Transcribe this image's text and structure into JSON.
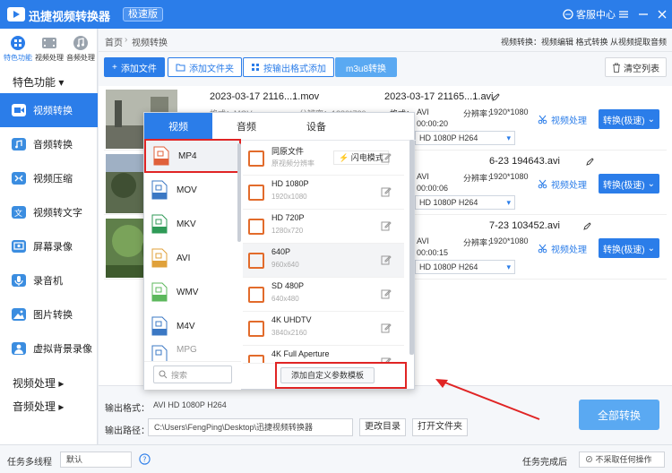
{
  "app": {
    "title": "迅捷视频转换器",
    "badge": "极速版",
    "service": "客服中心"
  },
  "sidebar": {
    "top_icons": [
      {
        "label": "特色功能",
        "icon": "grid-icon"
      },
      {
        "label": "视频处理",
        "icon": "film-icon"
      },
      {
        "label": "音频处理",
        "icon": "music-icon"
      }
    ],
    "section_featured": "特色功能",
    "items": [
      {
        "label": "视频转换",
        "icon": "video-convert-icon",
        "color": "#2b7de9"
      },
      {
        "label": "音频转换",
        "icon": "audio-convert-icon",
        "color": "#3b8de0"
      },
      {
        "label": "视频压缩",
        "icon": "compress-icon",
        "color": "#3b8de0"
      },
      {
        "label": "视频转文字",
        "icon": "video-to-text-icon",
        "color": "#3b8de0"
      },
      {
        "label": "屏幕录像",
        "icon": "screen-record-icon",
        "color": "#3b8de0"
      },
      {
        "label": "录音机",
        "icon": "recorder-icon",
        "color": "#3b8de0"
      },
      {
        "label": "图片转换",
        "icon": "image-convert-icon",
        "color": "#3b8de0"
      },
      {
        "label": "虚拟背景录像",
        "icon": "virtual-bg-icon",
        "color": "#3b8de0"
      }
    ],
    "section_video": "视频处理",
    "section_audio": "音频处理"
  },
  "breadcrumb": {
    "home": "首页",
    "current": "视频转换",
    "links": "视频转换：视频编辑 格式转换 从视频提取音频"
  },
  "toolbar": {
    "add_file": "添加文件",
    "add_folder": "添加文件夹",
    "add_by_format": "按输出格式添加",
    "m3u8": "m3u8转换",
    "clear": "清空列表"
  },
  "files": [
    {
      "src_name": "2023-03-17 2116...1.mov",
      "src_format": "格式：MOV",
      "src_res": "分辨率：1280*720",
      "out_name": "2023-03-17 21165...1.avi",
      "format_label": "格式：",
      "format": "AVI",
      "res_label": "分辨率：",
      "res": "1920*1080",
      "duration": "00:00:20",
      "preset": "HD 1080P H264",
      "process": "视频处理",
      "convert": "转换(极速)"
    },
    {
      "out_name": "6-23 194643.avi",
      "format": "AVI",
      "res_label": "分辨率：",
      "res": "1920*1080",
      "duration": "00:00:06",
      "preset": "HD 1080P H264",
      "process": "视频处理",
      "convert": "转换(极速)"
    },
    {
      "out_name": "7-23 103452.avi",
      "format": "AVI",
      "res_label": "分辨率：",
      "res": "1920*1080",
      "duration": "00:00:15",
      "preset": "HD 1080P H264",
      "process": "视频处理",
      "convert": "转换(极速)"
    }
  ],
  "popup": {
    "tabs": [
      "视频",
      "音频",
      "设备"
    ],
    "formats": [
      {
        "label": "MP4",
        "color": "#e0603a"
      },
      {
        "label": "MOV",
        "color": "#3b78c4"
      },
      {
        "label": "MKV",
        "color": "#2f9a57"
      },
      {
        "label": "AVI",
        "color": "#e0a13a"
      },
      {
        "label": "WMV",
        "color": "#5cb85c"
      },
      {
        "label": "M4V",
        "color": "#3b78c4"
      },
      {
        "label": "MPG",
        "color": "#3b78c4"
      }
    ],
    "search_placeholder": "搜索",
    "resolutions": [
      {
        "name": "同原文件",
        "desc": "原视频分辨率"
      },
      {
        "name": "HD 1080P",
        "desc": "1920x1080"
      },
      {
        "name": "HD 720P",
        "desc": "1280x720"
      },
      {
        "name": "640P",
        "desc": "960x640"
      },
      {
        "name": "SD 480P",
        "desc": "640x480"
      },
      {
        "name": "4K UHDTV",
        "desc": "3840x2160"
      },
      {
        "name": "4K Full Aperture",
        "desc": ""
      }
    ],
    "flash_mode": "闪电模式",
    "add_custom": "添加自定义参数模板"
  },
  "bottom": {
    "output_format_label": "输出格式：",
    "output_format": "AVI  HD 1080P H264",
    "output_path_label": "输出路径：",
    "output_path": "C:\\Users\\FengPing\\Desktop\\迅捷视频转换器",
    "change_dir": "更改目录",
    "open_folder": "打开文件夹",
    "convert_all": "全部转换"
  },
  "status": {
    "multithread_label": "任务多线程",
    "multithread_value": "默认",
    "after_label": "任务完成后",
    "after_value": "不采取任何操作"
  },
  "colors": {
    "accent": "#2b7de9",
    "highlight": "#e02424"
  }
}
